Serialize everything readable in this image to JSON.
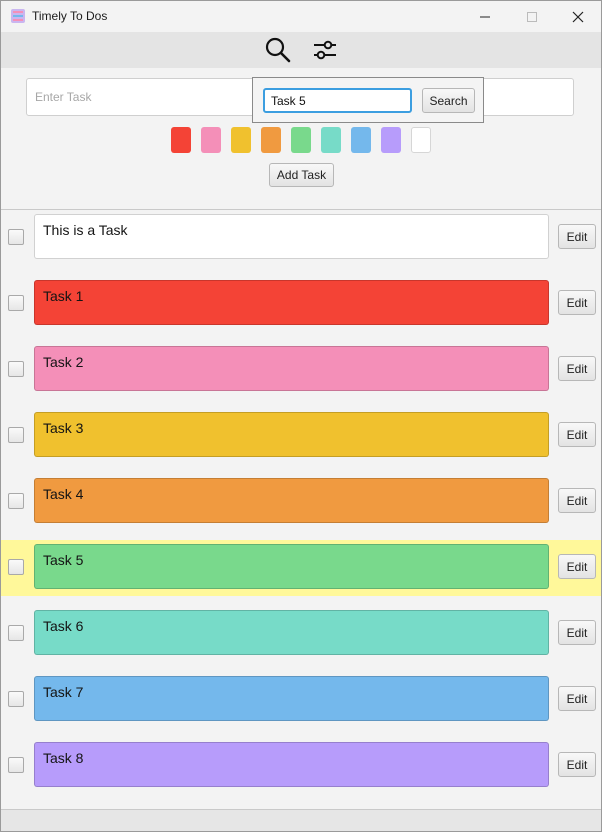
{
  "window": {
    "title": "Timely To Dos"
  },
  "toolbar": {
    "search_icon": "magnifier-icon",
    "filter_icon": "sliders-icon"
  },
  "entry": {
    "placeholder": "Enter Task",
    "add_label": "Add Task"
  },
  "colors": [
    "#f44336",
    "#f48fb8",
    "#f0c12e",
    "#f09a40",
    "#79d98c",
    "#77dbc8",
    "#74b8ec",
    "#b79cfb",
    "#ffffff"
  ],
  "search": {
    "value": "Task 5",
    "button_label": "Search"
  },
  "tasks": [
    {
      "text": "This is a Task",
      "color": "#ffffff",
      "edit": "Edit"
    },
    {
      "text": "Task 1",
      "color": "#f44336",
      "edit": "Edit"
    },
    {
      "text": "Task 2",
      "color": "#f48fb8",
      "edit": "Edit"
    },
    {
      "text": "Task 3",
      "color": "#f0c12e",
      "edit": "Edit"
    },
    {
      "text": "Task 4",
      "color": "#f09a40",
      "edit": "Edit"
    },
    {
      "text": "Task 5",
      "color": "#79d98c",
      "edit": "Edit",
      "highlighted": true
    },
    {
      "text": "Task 6",
      "color": "#77dbc8",
      "edit": "Edit"
    },
    {
      "text": "Task 7",
      "color": "#74b8ec",
      "edit": "Edit"
    },
    {
      "text": "Task 8",
      "color": "#b79cfb",
      "edit": "Edit"
    }
  ],
  "highlight_color": "#fff89a"
}
